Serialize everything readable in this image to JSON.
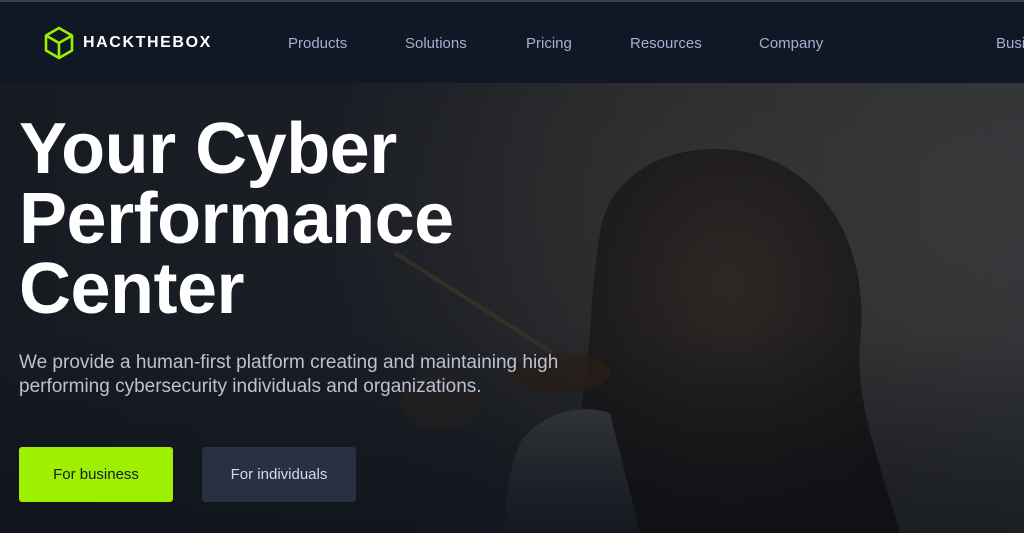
{
  "brand": {
    "name": "HACKTHEBOX",
    "accent_color": "#9fef00",
    "logo_icon": "cube-icon"
  },
  "nav": {
    "items": [
      {
        "label": "Products"
      },
      {
        "label": "Solutions"
      },
      {
        "label": "Pricing"
      },
      {
        "label": "Resources"
      },
      {
        "label": "Company"
      },
      {
        "label": "Busi"
      }
    ]
  },
  "hero": {
    "headline_lines": [
      "Your Cyber",
      "Performance",
      "Center"
    ],
    "subtext": "We provide a human-first platform creating and maintaining high performing cybersecurity individuals and organizations.",
    "primary_button": "For business",
    "secondary_button": "For individuals"
  },
  "colors": {
    "nav_background": "#101725",
    "primary_button": "#9fef00",
    "secondary_button": "#273142",
    "headline_text": "#ffffff",
    "nav_text": "#a4b1cd"
  }
}
